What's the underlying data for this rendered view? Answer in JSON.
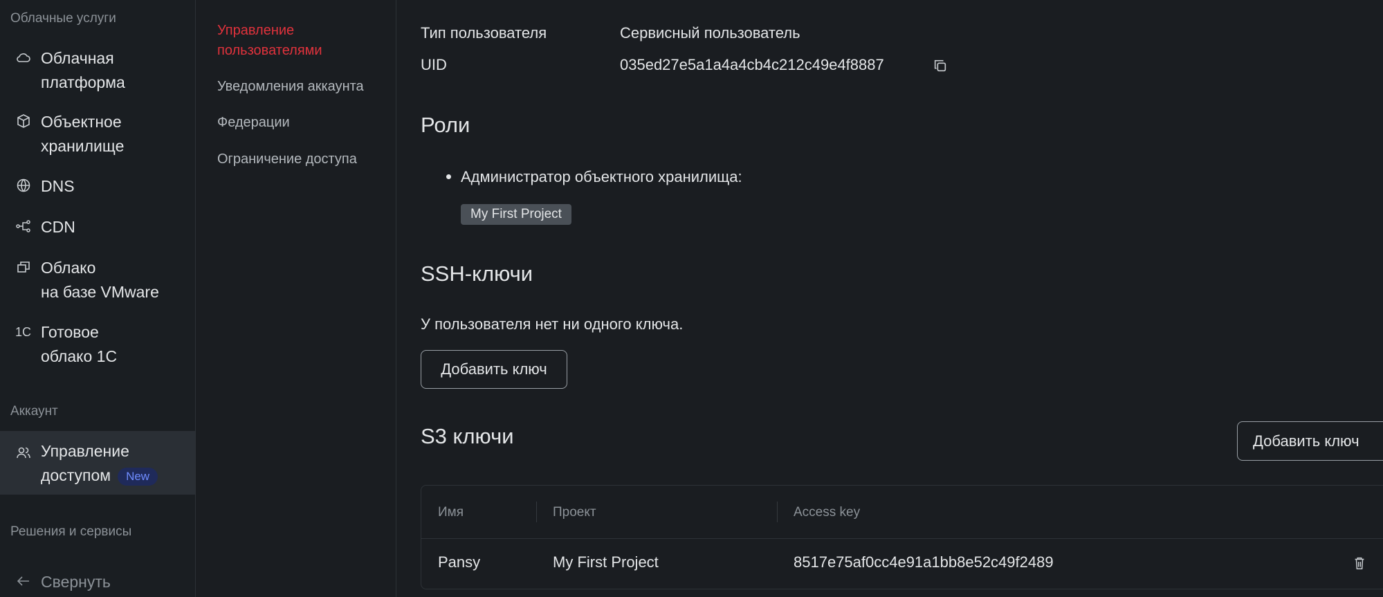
{
  "sidebar": {
    "group_cloud": "Облачные услуги",
    "items": [
      {
        "label": "Облачная\nплатформа",
        "icon": "cloud-icon"
      },
      {
        "label": "Объектное\nхранилище",
        "icon": "cube-icon"
      },
      {
        "label": "DNS",
        "icon": "globe-icon"
      },
      {
        "label": "CDN",
        "icon": "network-icon"
      },
      {
        "label": "Облако\nна базе VMware",
        "icon": "stack-icon"
      },
      {
        "label": "Готовое\nоблако 1С",
        "icon": "1c-icon",
        "icon_text": "1С"
      }
    ],
    "group_account": "Аккаунт",
    "active_item": {
      "label1": "Управление",
      "label2": "доступом",
      "badge": "New",
      "icon": "users-icon"
    },
    "group_solutions": "Решения и сервисы",
    "collapse": "Свернуть"
  },
  "subnav": {
    "items": [
      "Управление\nпользователями",
      "Уведомления аккаунта",
      "Федерации",
      "Ограничение доступа"
    ],
    "active": 0,
    "accent": "#e0323c"
  },
  "main": {
    "user_type_label": "Тип пользователя",
    "user_type_value": "Сервисный пользователь",
    "uid_label": "UID",
    "uid_value": "035ed27e5a1a4a4cb4c212c49e4f8887",
    "roles_title": "Роли",
    "role": "Администратор объектного хранилища:",
    "role_project": "My First Project",
    "ssh_title": "SSH-ключи",
    "ssh_empty": "У пользователя нет ни одного ключа.",
    "ssh_add": "Добавить ключ",
    "s3_title": "S3 ключи",
    "s3_add": "Добавить ключ",
    "table": {
      "columns": [
        "Имя",
        "Проект",
        "Access key"
      ],
      "rows": [
        {
          "name": "Pansy",
          "project": "My First Project",
          "access_key": "8517e75af0cc4e91a1bb8e52c49f2489"
        }
      ]
    }
  }
}
